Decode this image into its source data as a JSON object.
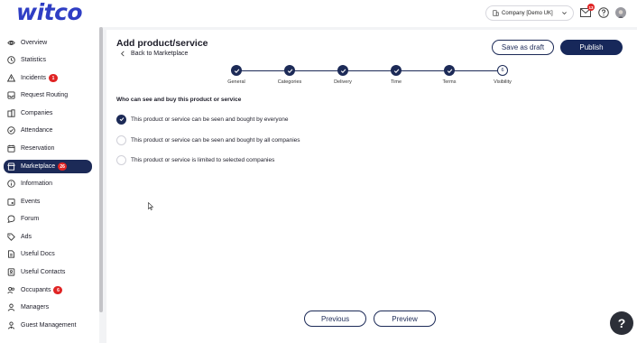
{
  "header": {
    "logo_text": "witco",
    "company_select": "Company [Demo UK]",
    "mail_badge": "13"
  },
  "sidebar": {
    "items": [
      {
        "label": "Overview",
        "icon": "eye-icon"
      },
      {
        "label": "Statistics",
        "icon": "clock-icon"
      },
      {
        "label": "Incidents",
        "icon": "warning-icon",
        "badge": "1"
      },
      {
        "label": "Request Routing",
        "icon": "inbox-icon"
      },
      {
        "label": "Companies",
        "icon": "buildings-icon"
      },
      {
        "label": "Attendance",
        "icon": "check-circle-icon"
      },
      {
        "label": "Reservation",
        "icon": "calendar-icon"
      },
      {
        "label": "Marketplace",
        "icon": "storefront-icon",
        "badge": "26",
        "active": true
      },
      {
        "label": "Information",
        "icon": "info-icon"
      },
      {
        "label": "Events",
        "icon": "calendar-event-icon"
      },
      {
        "label": "Forum",
        "icon": "chat-icon"
      },
      {
        "label": "Ads",
        "icon": "tag-icon"
      },
      {
        "label": "Useful Docs",
        "icon": "document-icon"
      },
      {
        "label": "Useful Contacts",
        "icon": "contacts-icon"
      },
      {
        "label": "Occupants",
        "icon": "users-icon",
        "badge": "6"
      },
      {
        "label": "Managers",
        "icon": "user-icon"
      },
      {
        "label": "Guest Management",
        "icon": "guest-icon"
      }
    ]
  },
  "page": {
    "title": "Add product/service",
    "back_label": "Back to Marketplace",
    "save_draft_label": "Save as draft",
    "publish_label": "Publish"
  },
  "steps": [
    {
      "label": "General",
      "done": true
    },
    {
      "label": "Categories",
      "done": true
    },
    {
      "label": "Delivery",
      "done": true
    },
    {
      "label": "Time",
      "done": true
    },
    {
      "label": "Terms",
      "done": true
    },
    {
      "label": "Visibility",
      "done": false,
      "number": "6"
    }
  ],
  "visibility": {
    "question": "Who can see and buy this product or service",
    "options": [
      {
        "label": "This product or service can be seen and bought by everyone",
        "checked": true
      },
      {
        "label": "This product or service can be seen and bought by all companies",
        "checked": false
      },
      {
        "label": "This product or service is limited to selected companies",
        "checked": false
      }
    ]
  },
  "footer": {
    "previous_label": "Previous",
    "preview_label": "Preview",
    "help_label": "?"
  },
  "colors": {
    "brand": "#2f3ec4",
    "navy": "#1c2a57",
    "badge_red": "#e02424"
  }
}
